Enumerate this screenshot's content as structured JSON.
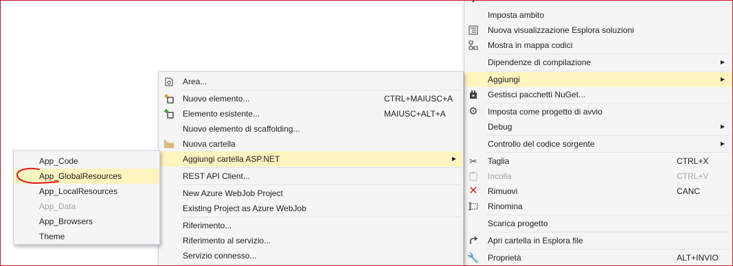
{
  "main_menu": {
    "items": [
      {
        "label": "Imposta ambito"
      },
      {
        "label": "Nuova visualizzazione Esplora soluzioni",
        "icon": "solution-explorer-view-icon"
      },
      {
        "label": "Mostra in mappa codici",
        "icon": "code-map-icon"
      },
      {
        "label": "Dipendenze di compilazione"
      },
      {
        "label": "Aggiungi"
      },
      {
        "label": "Gestisci pacchetti NuGet...",
        "icon": "nuget-package-icon"
      },
      {
        "label": "Imposta come progetto di avvio",
        "icon": "gear-icon"
      },
      {
        "label": "Debug"
      },
      {
        "label": "Controllo del codice sorgente"
      },
      {
        "label": "Taglia",
        "shortcut": "CTRL+X",
        "icon": "scissors-icon"
      },
      {
        "label": "Incolla",
        "shortcut": "CTRL+V",
        "icon": "clipboard-icon"
      },
      {
        "label": "Rimuovi",
        "shortcut": "CANC",
        "icon": "remove-x-icon"
      },
      {
        "label": "Rinomina",
        "icon": "rename-icon"
      },
      {
        "label": "Scarica progetto"
      },
      {
        "label": "Apri cartella in Esplora file",
        "icon": "open-folder-arrow-icon"
      },
      {
        "label": "Proprietà",
        "shortcut": "ALT+INVIO",
        "icon": "wrench-icon"
      }
    ]
  },
  "add_menu": {
    "items": [
      {
        "label": "Area...",
        "icon": "area-icon"
      },
      {
        "label": "Nuovo elemento...",
        "shortcut": "CTRL+MAIUSC+A",
        "icon": "new-item-icon"
      },
      {
        "label": "Elemento esistente...",
        "shortcut": "MAIUSC+ALT+A",
        "icon": "existing-item-icon"
      },
      {
        "label": "Nuovo elemento di scaffolding..."
      },
      {
        "label": "Nuova cartella",
        "icon": "folder-icon"
      },
      {
        "label": "Aggiungi cartella ASP.NET"
      },
      {
        "label": "REST API Client..."
      },
      {
        "label": "New Azure WebJob Project"
      },
      {
        "label": "Existing Project as Azure WebJob"
      },
      {
        "label": "Riferimento..."
      },
      {
        "label": "Riferimento al servizio..."
      },
      {
        "label": "Servizio connesso..."
      }
    ]
  },
  "aspnet_folders_menu": {
    "items": [
      {
        "label": "App_Code"
      },
      {
        "label": "App_GlobalResources"
      },
      {
        "label": "App_LocalResources"
      },
      {
        "label": "App_Data"
      },
      {
        "label": "App_Browsers"
      },
      {
        "label": "Theme"
      }
    ]
  },
  "colors": {
    "highlight": "#fdf4bf",
    "menu_background": "#f5f5f5",
    "menu_border": "#cccedb",
    "disabled_text": "#a2a4a5",
    "annotation_red": "#e8151b"
  }
}
